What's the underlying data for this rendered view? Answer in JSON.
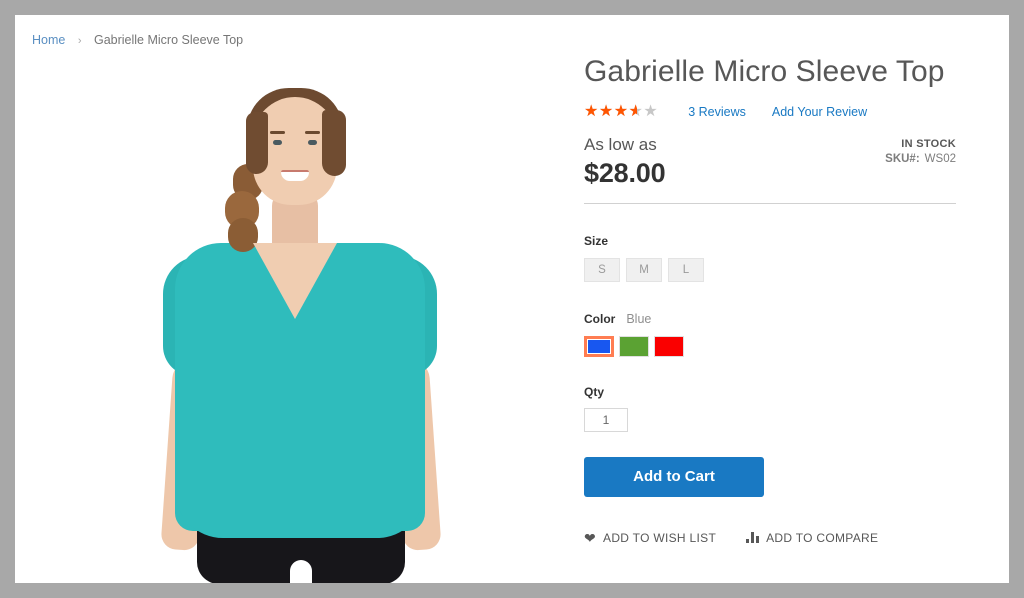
{
  "breadcrumb": {
    "home_label": "Home",
    "separator": "›",
    "current_label": "Gabrielle Micro Sleeve Top"
  },
  "product": {
    "title": "Gabrielle Micro Sleeve Top",
    "rating": {
      "stars_glyphs": "★★★★★",
      "value_percent": 72,
      "filled_color": "#ff5501",
      "empty_color": "#c7c7c7"
    },
    "reviews_link": "3  Reviews",
    "add_review_link": "Add Your Review",
    "price_prefix": "As low as",
    "price": "$28.00",
    "stock_status": "IN STOCK",
    "sku_label": "SKU#:",
    "sku_value": "WS02",
    "image_alt": "Woman wearing teal micro sleeve top and black shorts"
  },
  "options": {
    "size": {
      "label": "Size",
      "values": [
        {
          "label": "S",
          "selected": false
        },
        {
          "label": "M",
          "selected": false
        },
        {
          "label": "L",
          "selected": false
        }
      ]
    },
    "color": {
      "label": "Color",
      "selected_label": "Blue",
      "values": [
        {
          "name": "Blue",
          "hex": "#1857f0",
          "selected": true
        },
        {
          "name": "Green",
          "hex": "#5ba233",
          "selected": false
        },
        {
          "name": "Red",
          "hex": "#fa0000",
          "selected": false
        }
      ]
    }
  },
  "qty": {
    "label": "Qty",
    "value": "1"
  },
  "actions": {
    "add_to_cart": "Add to Cart",
    "add_to_wish_list": "ADD TO WISH LIST",
    "add_to_compare": "ADD TO COMPARE"
  },
  "theme": {
    "page_background": "#a8a8a8",
    "content_background": "#ffffff",
    "link_color": "#1979c3",
    "button_color": "#1979c3",
    "selected_swatch_border": "#ff7d52"
  }
}
